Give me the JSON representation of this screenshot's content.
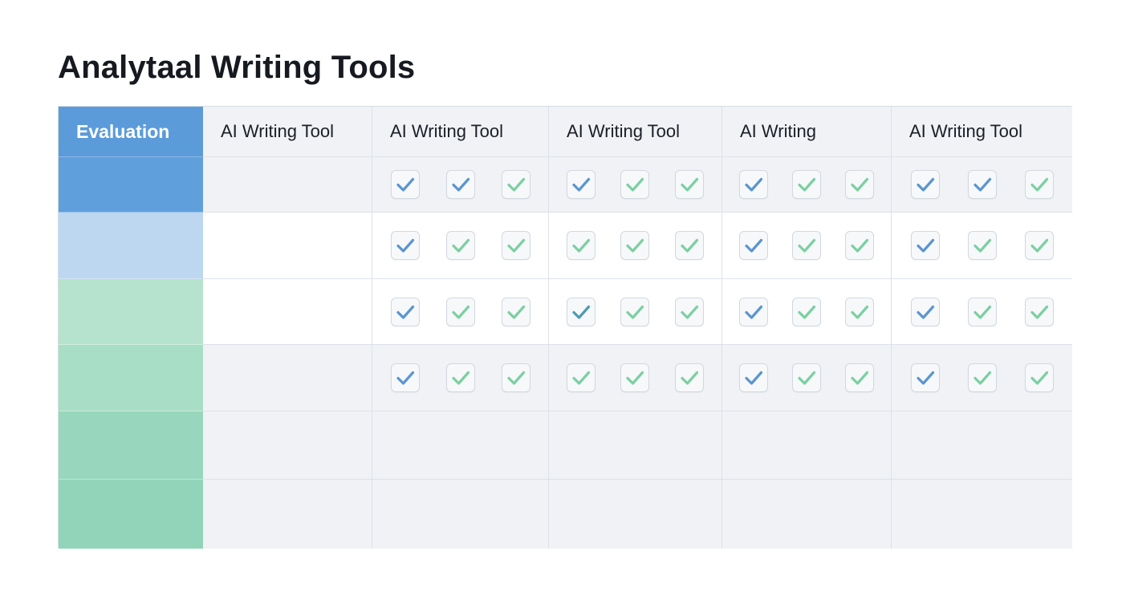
{
  "title": "Analytaal Writing Tools",
  "table": {
    "corner_label": "Evaluation",
    "columns": [
      {
        "label": "AI Writing Tool"
      },
      {
        "label": "AI Writing Tool"
      },
      {
        "label": "AI Writing Tool"
      },
      {
        "label": "AI Writing"
      },
      {
        "label": "AI Writing Tool"
      }
    ],
    "row_colors": [
      "#5f9fdc",
      "#bdd7f0",
      "#b6e3cd",
      "#a9dec6",
      "#98d7bd",
      "#92d4b9"
    ],
    "row_shading": [
      "gray",
      "white",
      "white",
      "gray",
      "gray",
      "gray"
    ],
    "check_colors": {
      "blue": "#5b95cf",
      "green": "#7ccfa2"
    },
    "checks": [
      [
        [],
        [
          "blue",
          "blue",
          "green"
        ],
        [
          "blue",
          "green",
          "green"
        ],
        [
          "blue",
          "green",
          "green"
        ],
        [
          "blue",
          "blue",
          "green"
        ]
      ],
      [
        [],
        [
          "blue",
          "green",
          "green"
        ],
        [
          "green",
          "green",
          "green"
        ],
        [
          "blue",
          "green",
          "green"
        ],
        [
          "blue",
          "green",
          "green"
        ]
      ],
      [
        [],
        [
          "blue",
          "green",
          "green"
        ],
        [
          "teal",
          "green",
          "green"
        ],
        [
          "blue",
          "green",
          "green"
        ],
        [
          "blue",
          "green",
          "green"
        ]
      ],
      [
        [],
        [
          "blue",
          "green",
          "green"
        ],
        [
          "green",
          "green",
          "green"
        ],
        [
          "blue",
          "green",
          "green"
        ],
        [
          "blue",
          "green",
          "green"
        ]
      ],
      [
        [],
        [],
        [],
        [],
        []
      ],
      [
        [],
        [],
        [],
        [],
        []
      ]
    ]
  }
}
